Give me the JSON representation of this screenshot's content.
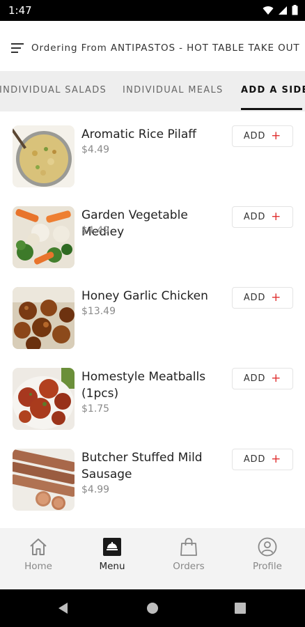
{
  "status_bar": {
    "time": "1:47"
  },
  "header": {
    "title": "Ordering From ANTIPASTOS - HOT TABLE TAKE OUT"
  },
  "tabs": [
    {
      "label": "INDIVIDUAL SALADS",
      "active": false
    },
    {
      "label": "INDIVIDUAL MEALS",
      "active": false
    },
    {
      "label": "ADD A SIDE",
      "active": true
    }
  ],
  "items": [
    {
      "name": "Aromatic Rice Pilaff",
      "price": "$4.49",
      "add_label": "ADD",
      "image": "rice-pilaf-image"
    },
    {
      "name": "Garden Vegetable Medley",
      "price": "$4.49",
      "add_label": "ADD",
      "image": "vegetable-medley-image"
    },
    {
      "name": "Honey Garlic Chicken",
      "price": "$13.49",
      "add_label": "ADD",
      "image": "honey-garlic-chicken-image"
    },
    {
      "name": "Homestyle Meatballs (1pcs)",
      "price": "$1.75",
      "add_label": "ADD",
      "image": "meatballs-image"
    },
    {
      "name": "Butcher Stuffed Mild Sausage",
      "price": "$4.99",
      "add_label": "ADD",
      "image": "sausage-image"
    }
  ],
  "bottom_nav": [
    {
      "label": "Home",
      "icon": "home-icon",
      "active": false
    },
    {
      "label": "Menu",
      "icon": "menu-icon",
      "active": true
    },
    {
      "label": "Orders",
      "icon": "shopping-bag-icon",
      "active": false
    },
    {
      "label": "Profile",
      "icon": "profile-icon",
      "active": false
    }
  ],
  "colors": {
    "accent_plus": "#e03030",
    "tab_bar_bg": "#eeeeee",
    "nav_bg": "#f3f3f3"
  }
}
